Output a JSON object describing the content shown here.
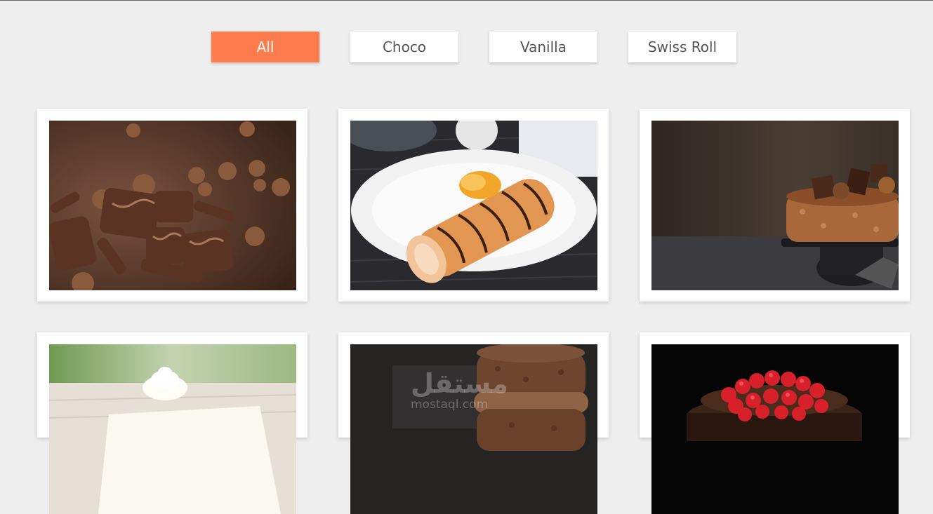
{
  "filters": [
    {
      "label": "All",
      "active": true
    },
    {
      "label": "Choco",
      "active": false
    },
    {
      "label": "Vanilla",
      "active": false
    },
    {
      "label": "Swiss Roll",
      "active": false
    }
  ],
  "gallery": {
    "items": [
      {
        "subject": "chocolate candies with hazelnuts"
      },
      {
        "subject": "swiss roll on white plate"
      },
      {
        "subject": "chocolate cake on stand"
      },
      {
        "subject": "vanilla cream cake slice"
      },
      {
        "subject": "chocolate layer cake"
      },
      {
        "subject": "chocolate cake with raspberries"
      }
    ]
  },
  "watermark": {
    "arabic": "مستقل",
    "latin": "mostaql.com"
  },
  "colors": {
    "accent": "#fd7b4d",
    "background": "#eeeeee",
    "card": "#ffffff"
  }
}
